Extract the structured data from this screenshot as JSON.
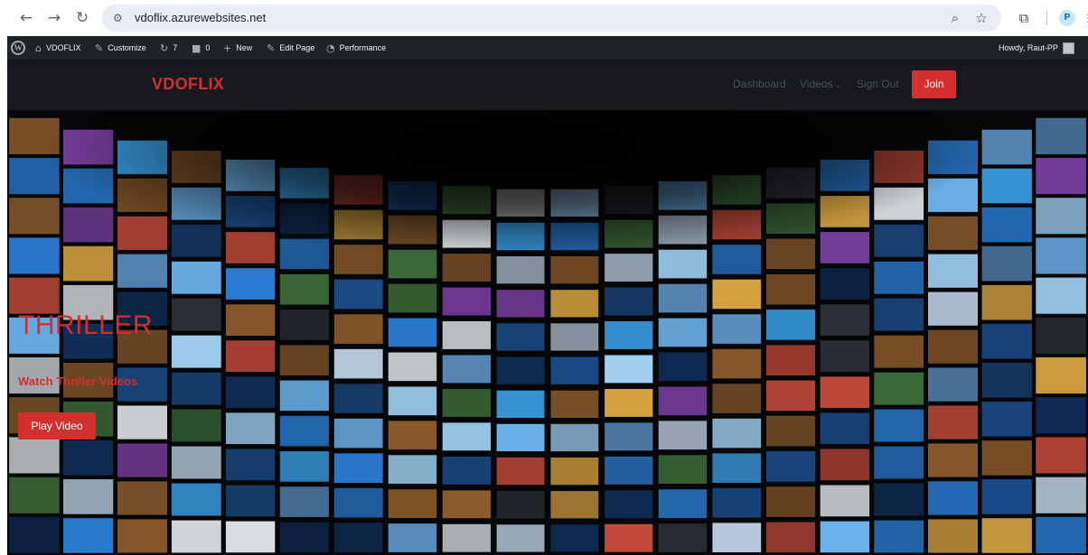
{
  "browser": {
    "url": "vdoflix.azurewebsites.net",
    "profile_initial": "P",
    "icons": {
      "back": "←",
      "forward": "→",
      "reload": "↻",
      "site_info": "⚙",
      "zoom": "⌕",
      "bookmark": "☆",
      "extensions": "⧉",
      "menu": "⋮"
    }
  },
  "admin_bar": {
    "site_name": "VDOFLIX",
    "customize": "Customize",
    "updates_count": "7",
    "comments_count": "0",
    "new": "New",
    "edit_page": "Edit Page",
    "performance": "Performance",
    "howdy": "Howdy, Raut-PP",
    "icons": {
      "wp_logo": "W",
      "dashboard": "⌂",
      "customize": "✎",
      "updates": "↻",
      "comments": "■",
      "new": "+",
      "edit": "✎",
      "performance": "◔"
    }
  },
  "site": {
    "logo": "VDOFLIX",
    "nav": {
      "dashboard": "Dashboard",
      "videos": "Videos",
      "videos_chevron": "⌄",
      "sign_out": "Sign Out",
      "join": "Join"
    }
  },
  "hero": {
    "title": "THRILLER",
    "subtitle": "Watch Thriller Videos",
    "button": "Play Video"
  },
  "colors": {
    "accent": "#d32f2f",
    "admin_bar": "#1d2327",
    "header": "#17191f"
  }
}
